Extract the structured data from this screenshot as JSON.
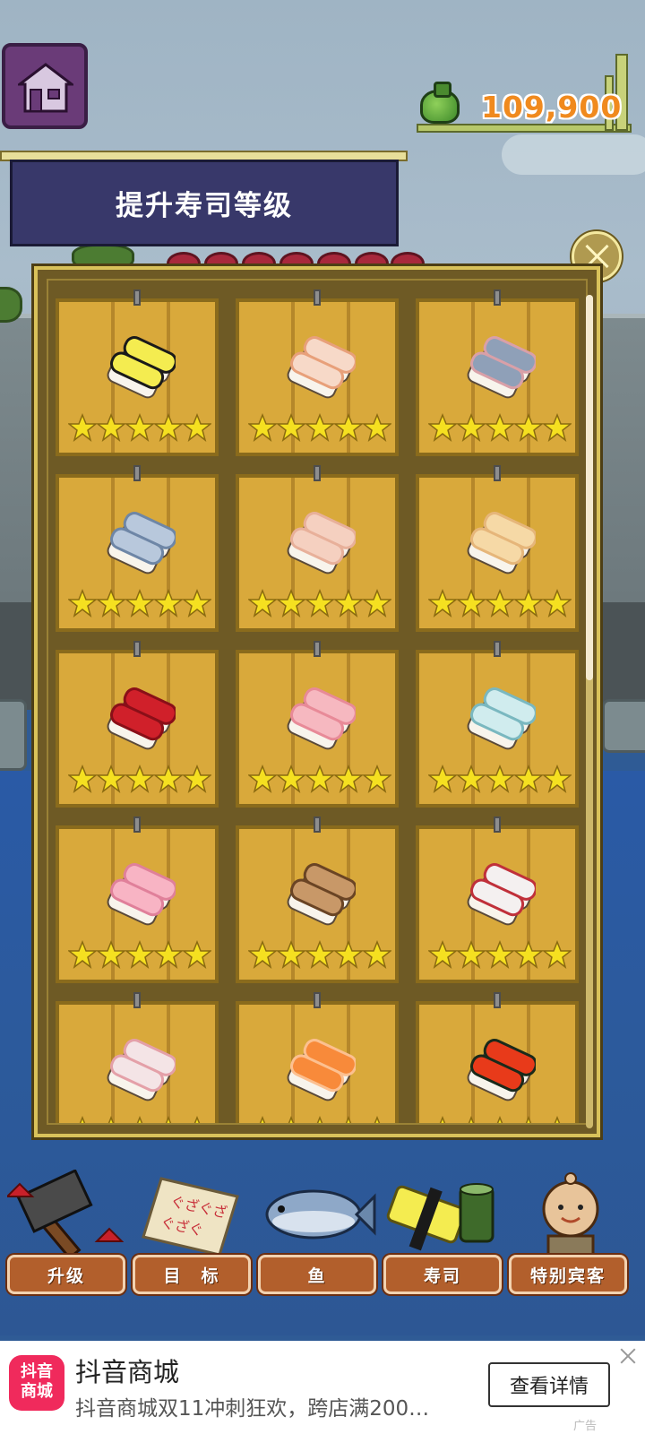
{
  "wallet": {
    "amount": "109,900",
    "icon": "money-bag-icon"
  },
  "banner": {
    "title": "提升寿司等级"
  },
  "home": {
    "icon": "house-icon"
  },
  "close": {
    "icon": "close-icon"
  },
  "sushi_cards": [
    {
      "kind": "tamago",
      "stars": 5,
      "colors": [
        "#f4ec50",
        "#1a1a1a"
      ]
    },
    {
      "kind": "shrimp",
      "stars": 5,
      "colors": [
        "#f7d9c8",
        "#e8a07a"
      ]
    },
    {
      "kind": "aji",
      "stars": 5,
      "colors": [
        "#8fa0b8",
        "#d9a0a8"
      ]
    },
    {
      "kind": "saba",
      "stars": 5,
      "colors": [
        "#b8c8dc",
        "#6e86a6"
      ]
    },
    {
      "kind": "hotate",
      "stars": 5,
      "colors": [
        "#f5d0c0",
        "#e8b09a"
      ]
    },
    {
      "kind": "engawa",
      "stars": 5,
      "colors": [
        "#f6d9a6",
        "#e6b67a"
      ]
    },
    {
      "kind": "maguro",
      "stars": 5,
      "colors": [
        "#d0202a",
        "#8a0f18"
      ]
    },
    {
      "kind": "hamachi",
      "stars": 5,
      "colors": [
        "#f6b8c0",
        "#e88a98"
      ]
    },
    {
      "kind": "hirame",
      "stars": 5,
      "colors": [
        "#d0ecee",
        "#7ab8c0"
      ]
    },
    {
      "kind": "tai",
      "stars": 5,
      "colors": [
        "#f8b4c4",
        "#e0809a"
      ]
    },
    {
      "kind": "unagi",
      "stars": 5,
      "colors": [
        "#c89868",
        "#6a4424"
      ]
    },
    {
      "kind": "tako",
      "stars": 5,
      "colors": [
        "#f4f0f0",
        "#c0303a"
      ]
    },
    {
      "kind": "kanpachi",
      "stars": 5,
      "colors": [
        "#f4e4e6",
        "#e4a0a8"
      ]
    },
    {
      "kind": "salmon",
      "stars": 5,
      "colors": [
        "#f88a3a",
        "#fcc090"
      ]
    },
    {
      "kind": "ikura",
      "stars": 5,
      "colors": [
        "#e83a1a",
        "#1a2a1a"
      ]
    }
  ],
  "menu": [
    {
      "label": "升级",
      "icon": "hammer-icon"
    },
    {
      "label": "目　标",
      "icon": "target-sheet-icon"
    },
    {
      "label": "鱼",
      "icon": "fish-icon"
    },
    {
      "label": "寿司",
      "icon": "sushi-icon"
    },
    {
      "label": "特别宾客",
      "icon": "guest-icon"
    }
  ],
  "ad": {
    "logo": "抖音\n商城",
    "title": "抖音商城",
    "subtitle": "抖音商城双11冲刺狂欢，跨店满200…",
    "button": "查看详情",
    "tag": "广告"
  },
  "colors": {
    "panel": "#6e5a25",
    "card": "#d9a93b",
    "star": "#f5e020",
    "banner": "#38386a",
    "menu": "#b25f2c",
    "money": "#f08a1e"
  }
}
